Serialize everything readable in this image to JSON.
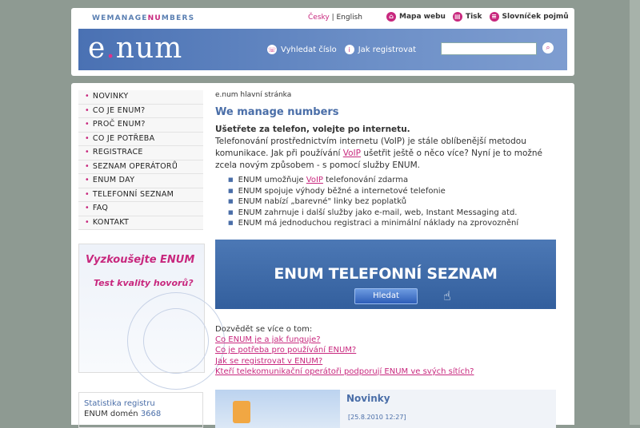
{
  "header": {
    "brand_a": "WEMANAGE",
    "brand_b": "NU",
    "brand_c": "MBERS",
    "lang_active": "Česky",
    "lang_sep": " | ",
    "lang_other": "English",
    "links": [
      {
        "label": "Mapa webu",
        "icon": "map-icon"
      },
      {
        "label": "Tisk",
        "icon": "print-icon"
      },
      {
        "label": "Slovníček pojmů",
        "icon": "glossary-icon"
      }
    ],
    "logo_a": "e",
    "logo_dot": ".",
    "logo_b": "num",
    "banner_links": [
      {
        "label": "Vyhledat číslo",
        "icon": "phone-search-icon"
      },
      {
        "label": "Jak registrovat",
        "icon": "info-icon"
      }
    ],
    "search_placeholder": ""
  },
  "menu": [
    "NOVINKY",
    "CO JE ENUM?",
    "PROČ ENUM?",
    "CO JE POTŘEBA",
    "REGISTRACE",
    "SEZNAM OPERÁTORŮ",
    "ENUM DAY",
    "TELEFONNÍ SEZNAM",
    "FAQ",
    "KONTAKT"
  ],
  "promo": {
    "line1": "Vyzkoušejte ENUM",
    "line2": "Test kvality hovorů?"
  },
  "stats": {
    "title": "Statistika registru",
    "label": "ENUM domén",
    "count": "3668"
  },
  "content": {
    "breadcrumb": "e.num hlavní stránka",
    "heading": "We manage numbers",
    "lead_bold": "Ušetřete za telefon, volejte po internetu.",
    "lead_1": "Telefonování prostřednictvím internetu (VoIP) je stále oblíbenější metodou komunikace. Jak při používání ",
    "lead_voip": "VoIP",
    "lead_2": " ušetřit ještě o něco více? Nyní je to možné zcela novým způsobem - s pomocí služby ENUM.",
    "bullet1_a": "ENUM umožňuje ",
    "bullet1_voip": "VoIP",
    "bullet1_b": " telefonování zdarma",
    "bullets": [
      "ENUM spojuje výhody běžné a internetové telefonie",
      "ENUM nabízí „barevné\" linky bez poplatků",
      "ENUM zahrnuje i další služby jako e-mail, web, Instant Messaging atd.",
      "ENUM má jednoduchou registraci a minimální náklady na zprovoznění"
    ],
    "banner_title": "ENUM TELEFONNÍ SEZNAM",
    "banner_button": "Hledat",
    "more_title": "Dozvědět se více o tom:",
    "more_links": [
      "Co ENUM je a jak funguje?",
      "Co je potřeba pro používání ENUM?",
      "Jak se registrovat v ENUM?",
      "Kteří telekomunikační operátoři podporují ENUM ve svých sítích?"
    ],
    "news_title": "Novinky",
    "news_date": "[25.8.2010 12:27]"
  }
}
